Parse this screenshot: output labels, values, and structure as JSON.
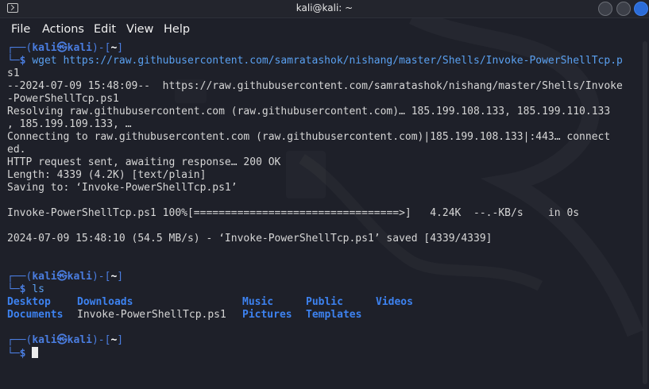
{
  "window": {
    "title": "kali@kali: ~",
    "menu": [
      "File",
      "Actions",
      "Edit",
      "View",
      "Help"
    ]
  },
  "prompts": [
    {
      "user": "kali",
      "at": "㉿",
      "host": "kali",
      "path": "~",
      "command": "wget https://raw.githubusercontent.com/samratashok/nishang/master/Shells/Invoke-PowerShellTcp.p",
      "command_cont": "s1"
    },
    {
      "user": "kali",
      "at": "㉿",
      "host": "kali",
      "path": "~",
      "command": "ls"
    },
    {
      "user": "kali",
      "at": "㉿",
      "host": "kali",
      "path": "~",
      "command": ""
    }
  ],
  "wget_output": [
    "--2024-07-09 15:48:09--  https://raw.githubusercontent.com/samratashok/nishang/master/Shells/Invoke",
    "-PowerShellTcp.ps1",
    "Resolving raw.githubusercontent.com (raw.githubusercontent.com)… 185.199.108.133, 185.199.110.133",
    ", 185.199.109.133, …",
    "Connecting to raw.githubusercontent.com (raw.githubusercontent.com)|185.199.108.133|:443… connect",
    "ed.",
    "HTTP request sent, awaiting response… 200 OK",
    "Length: 4339 (4.2K) [text/plain]",
    "Saving to: ‘Invoke-PowerShellTcp.ps1’"
  ],
  "progress": {
    "file": "Invoke-PowerShellTcp.ps1",
    "percent": "100%",
    "bar": "[=================================>]",
    "size": "4.24K",
    "rate": "--.-KB/s",
    "eta": "in 0s"
  },
  "saved_line": "2024-07-09 15:48:10 (54.5 MB/s) - ‘Invoke-PowerShellTcp.ps1’ saved [4339/4339]",
  "ls_output": {
    "row1": [
      "Desktop",
      "Downloads",
      "Music",
      "Public",
      "Videos"
    ],
    "row2": [
      "Documents",
      "Invoke-PowerShellTcp.ps1",
      "Pictures",
      "Templates"
    ]
  },
  "colors": {
    "prompt_frame": "#4a7de0",
    "directory": "#3d82f0",
    "text": "#d6d6d6",
    "background": "#1e2029"
  }
}
